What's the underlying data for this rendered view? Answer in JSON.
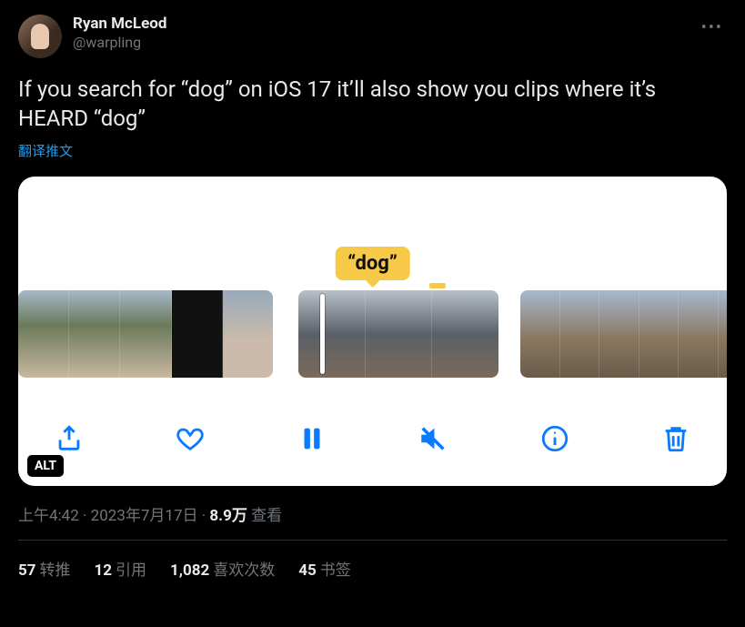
{
  "author": {
    "display_name": "Ryan McLeod",
    "handle": "@warpling"
  },
  "body": "If you search for “dog” on iOS 17 it’ll also show you clips where it’s HEARD “dog”",
  "translate_label": "翻译推文",
  "media": {
    "tooltip": "“dog”",
    "alt_badge": "ALT"
  },
  "meta": {
    "time": "上午4:42",
    "date": "2023年7月17日",
    "sep": " · ",
    "views_count": "8.9万",
    "views_label": " 查看"
  },
  "stats": {
    "retweets": {
      "count": "57",
      "label": "转推"
    },
    "quotes": {
      "count": "12",
      "label": "引用"
    },
    "likes": {
      "count": "1,082",
      "label": "喜欢次数"
    },
    "bookmarks": {
      "count": "45",
      "label": "书签"
    }
  }
}
